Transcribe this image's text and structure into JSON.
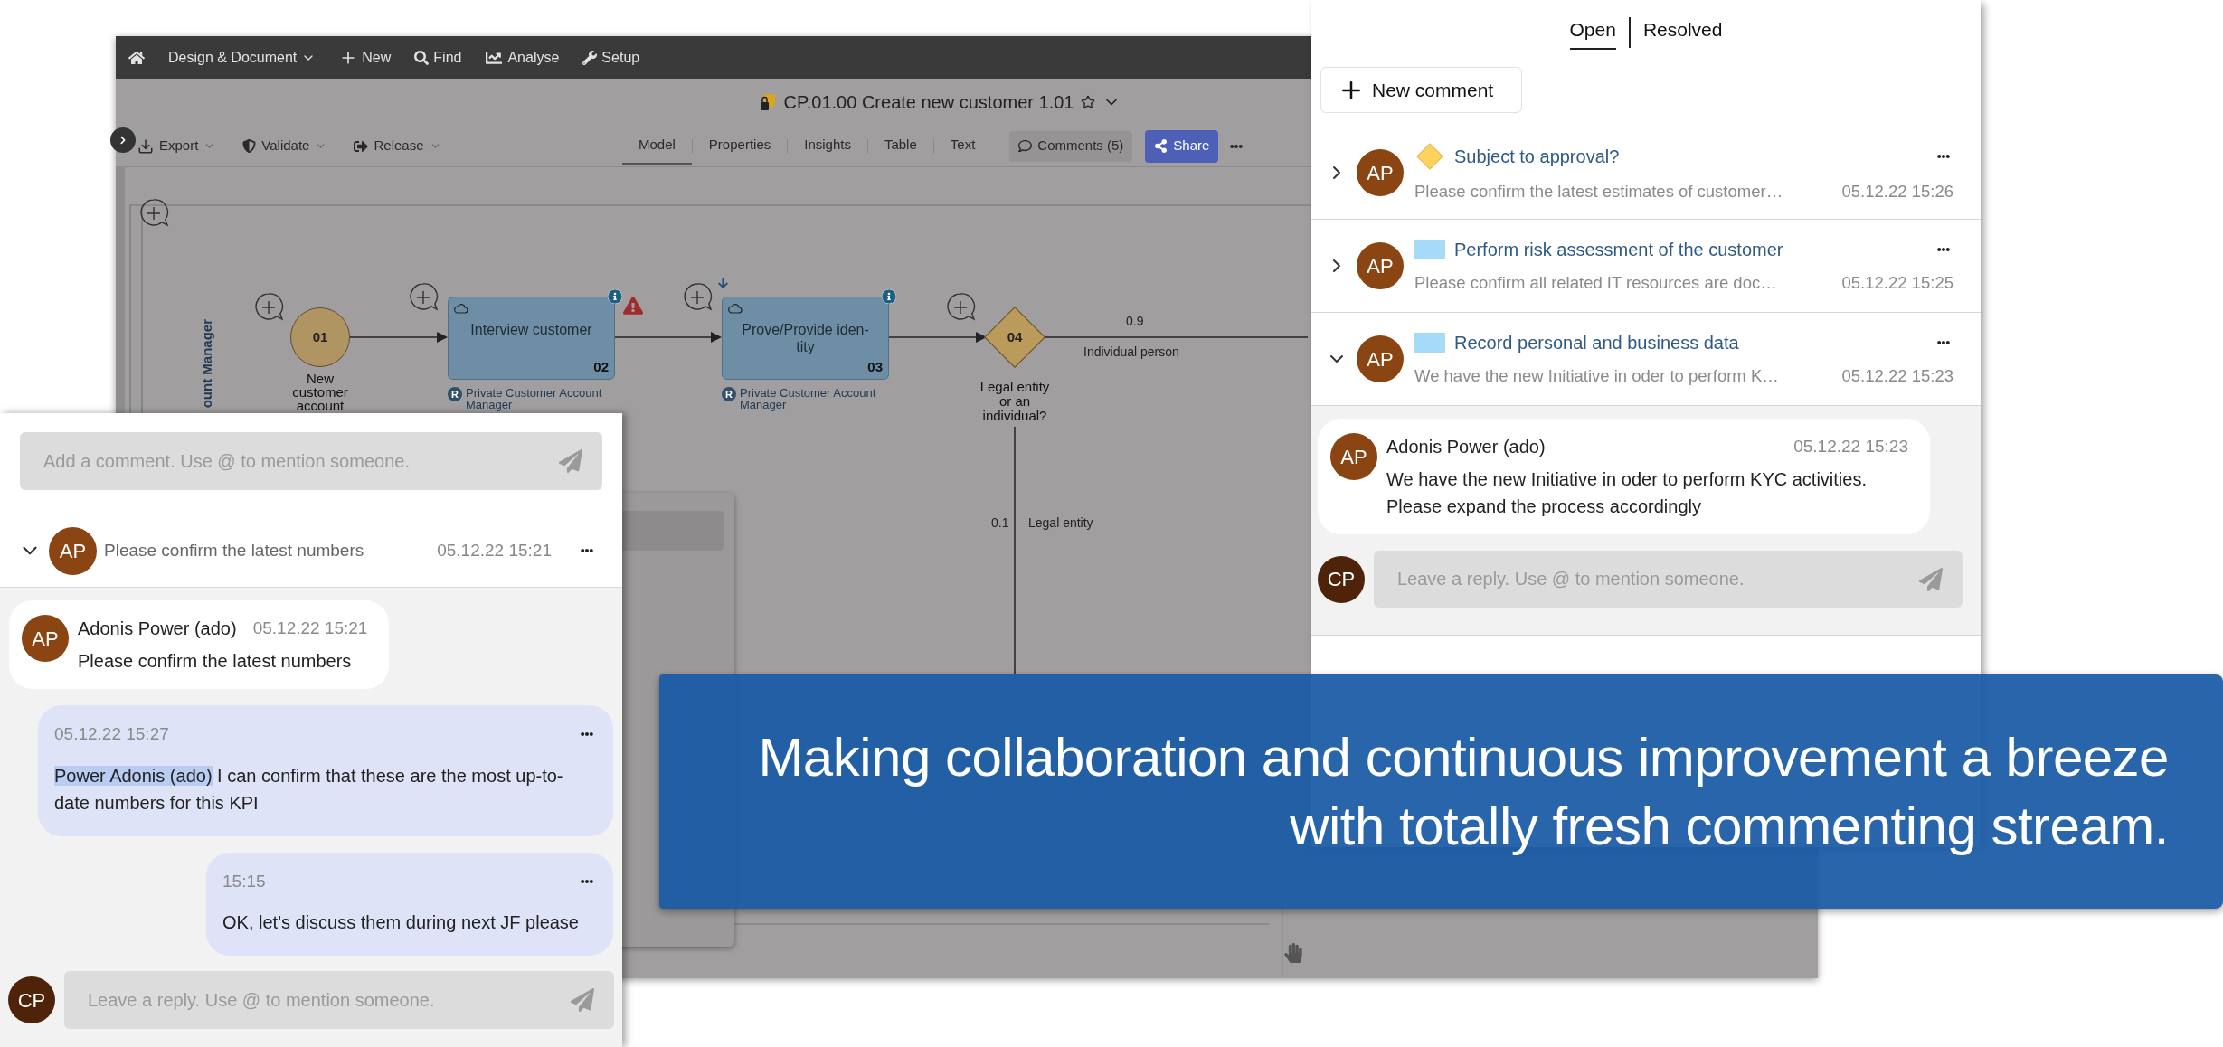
{
  "app": {
    "menu": [
      {
        "kind": "home"
      },
      {
        "kind": "dropdown",
        "label": "Design & Document"
      },
      {
        "kind": "new",
        "label": "New"
      },
      {
        "kind": "find",
        "label": "Find"
      },
      {
        "kind": "analyse",
        "label": "Analyse"
      },
      {
        "kind": "setup",
        "label": "Setup"
      }
    ],
    "title": "CP.01.00 Create new customer 1.01",
    "toolbar": [
      {
        "kind": "export",
        "label": "Export"
      },
      {
        "kind": "validate",
        "label": "Validate"
      },
      {
        "kind": "release",
        "label": "Release"
      }
    ],
    "view_tabs": [
      {
        "label": "Model",
        "selected": true
      },
      {
        "label": "Properties",
        "selected": false
      },
      {
        "label": "Insights",
        "selected": false
      },
      {
        "label": "Table",
        "selected": false
      },
      {
        "label": "Text",
        "selected": false
      }
    ],
    "comments_button": "Comments (5)",
    "share_button": "Share",
    "diagram": {
      "lane": "ount Manager",
      "nodes": [
        {
          "kind": "event",
          "number": "01",
          "label": "New\ncustomer\naccount"
        },
        {
          "kind": "task",
          "number": "02",
          "label": "Interview customer",
          "role_badge": "R",
          "role": "Private Customer Account\nManager",
          "warning": true
        },
        {
          "kind": "task",
          "number": "03",
          "label": "Prove/Provide iden-\ntity",
          "role_badge": "R",
          "role": "Private Customer Account\nManager",
          "warning": false
        },
        {
          "kind": "gateway",
          "number": "04",
          "label": "Legal entity\nor an\nindividual?"
        }
      ],
      "branches": [
        {
          "probability": "0.9",
          "label": "Individual person"
        },
        {
          "probability": "0.1",
          "label": "Legal entity"
        }
      ]
    }
  },
  "thread_panel": {
    "placeholder": "Add a comment. Use @ to mention someone.",
    "thread": {
      "expanded": true,
      "avatar": "AP",
      "title": "Please confirm the latest numbers",
      "date": "05.12.22 15:21"
    },
    "messages": [
      {
        "kind": "received",
        "avatar": "AP",
        "author": "Adonis Power (ado)",
        "date": "05.12.22 15:21",
        "text": "Please confirm the latest numbers"
      },
      {
        "kind": "own",
        "date": "05.12.22 15:27",
        "mention": "Power Adonis (ado)",
        "text": "I can confirm that these are the most up-to-date numbers for this KPI"
      },
      {
        "kind": "own",
        "date": "15:15",
        "text": "OK, let's discuss them during next JF please"
      }
    ],
    "reply": {
      "avatar": "CP",
      "placeholder": "Leave a reply. Use @ to mention someone."
    }
  },
  "comments_panel": {
    "tabs": [
      {
        "label": "Open",
        "selected": true
      },
      {
        "label": "Resolved",
        "selected": false
      }
    ],
    "new_comment": "New comment",
    "threads": [
      {
        "kind": "gateway",
        "expanded": false,
        "avatar": "AP",
        "title": "Subject to approval?",
        "preview": "Please confirm the latest estimates of customer…",
        "date": "05.12.22 15:26"
      },
      {
        "kind": "task",
        "expanded": false,
        "avatar": "AP",
        "title": "Perform risk assessment of the customer",
        "preview": "Please confirm all related IT resources are doc…",
        "date": "05.12.22 15:25"
      },
      {
        "kind": "task",
        "expanded": true,
        "avatar": "AP",
        "title": "Record personal and business data",
        "preview": "We have the new Initiative in oder to perform K…",
        "date": "05.12.22 15:23",
        "messages": [
          {
            "kind": "received",
            "avatar": "AP",
            "author": "Adonis Power (ado)",
            "date": "05.12.22 15:23",
            "text": "We have the new Initiative in oder to perform KYC activities. Please expand the process accordingly"
          }
        ],
        "reply": {
          "avatar": "CP",
          "placeholder": "Leave a reply. Use @ to mention someone."
        }
      }
    ]
  },
  "banner": {
    "text": "Making collaboration and continuous improvement a breeze\nwith totally fresh commenting stream."
  }
}
